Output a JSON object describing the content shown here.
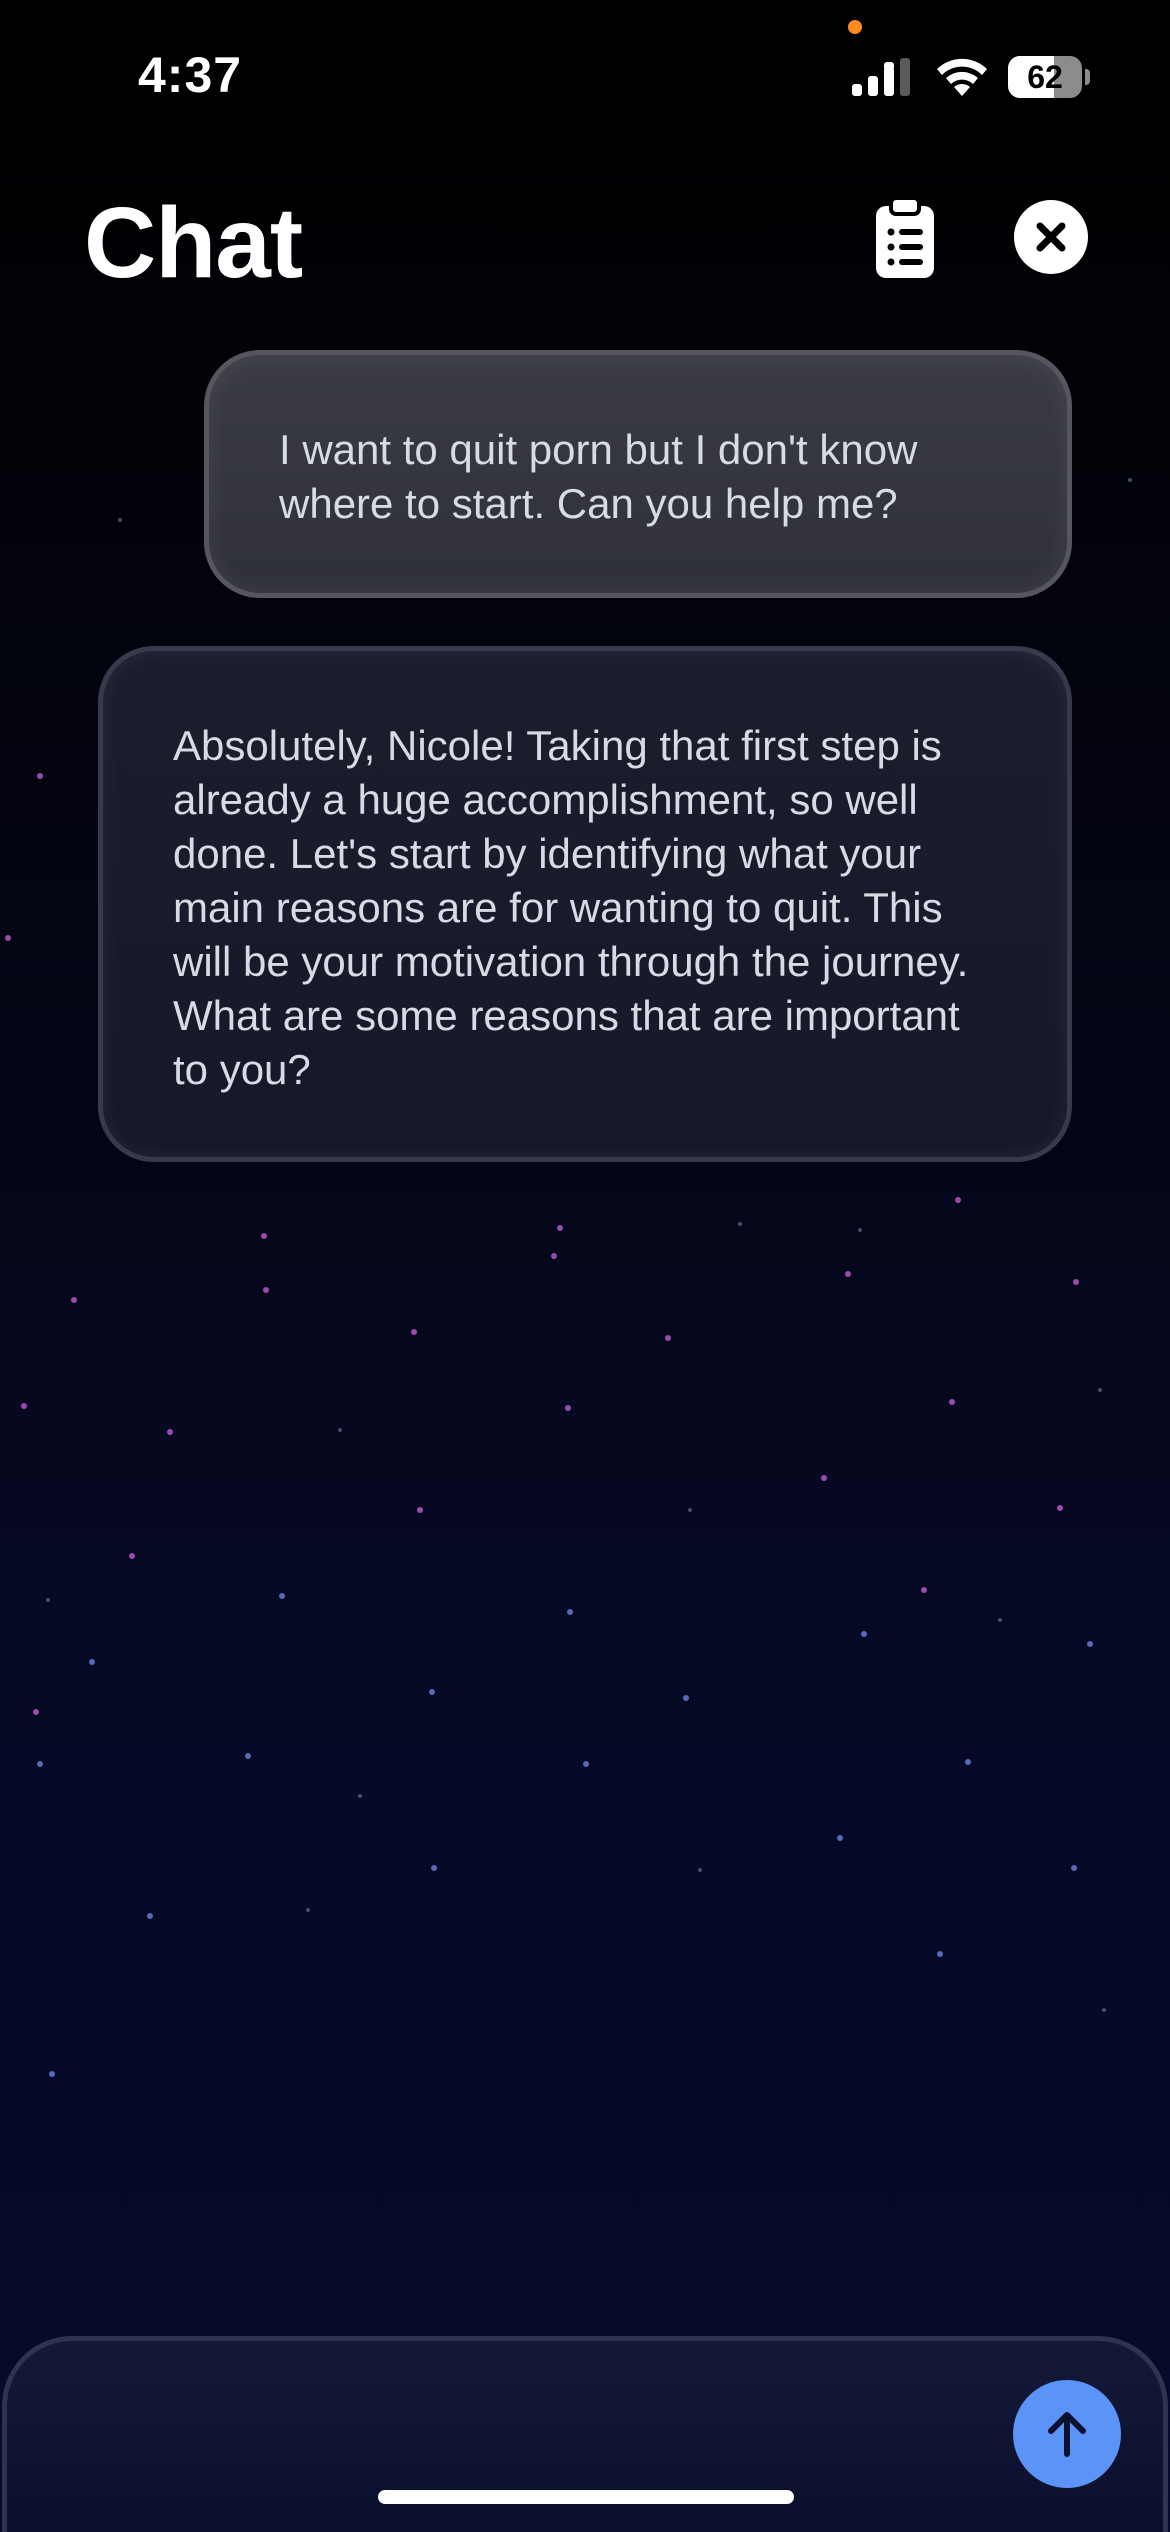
{
  "status_bar": {
    "time": "4:37",
    "battery_level": "62",
    "privacy_indicator_color": "#ff8a1e",
    "icons": [
      "signal-icon",
      "wifi-icon",
      "battery-icon"
    ]
  },
  "header": {
    "title": "Chat",
    "actions": [
      "clipboard-list-icon",
      "close-icon"
    ]
  },
  "messages": [
    {
      "role": "user",
      "text": "I want to quit porn but I don't know where to start. Can you help me?"
    },
    {
      "role": "assistant",
      "text": "Absolutely, Nicole! Taking that first step is already a huge accomplishment, so well done. Let's start by identifying what your main reasons are for wanting to quit. This will be your motivation through the journey. What are some reasons that are important to you?"
    }
  ],
  "composer": {
    "input_value": "",
    "send_icon": "arrow-up-icon",
    "send_color": "#5b93f7"
  },
  "colors": {
    "background_top": "#000000",
    "background_bottom": "#070b2c",
    "user_bubble": "#34353d",
    "assistant_bubble": "#181b2b",
    "accent": "#5b93f7"
  }
}
